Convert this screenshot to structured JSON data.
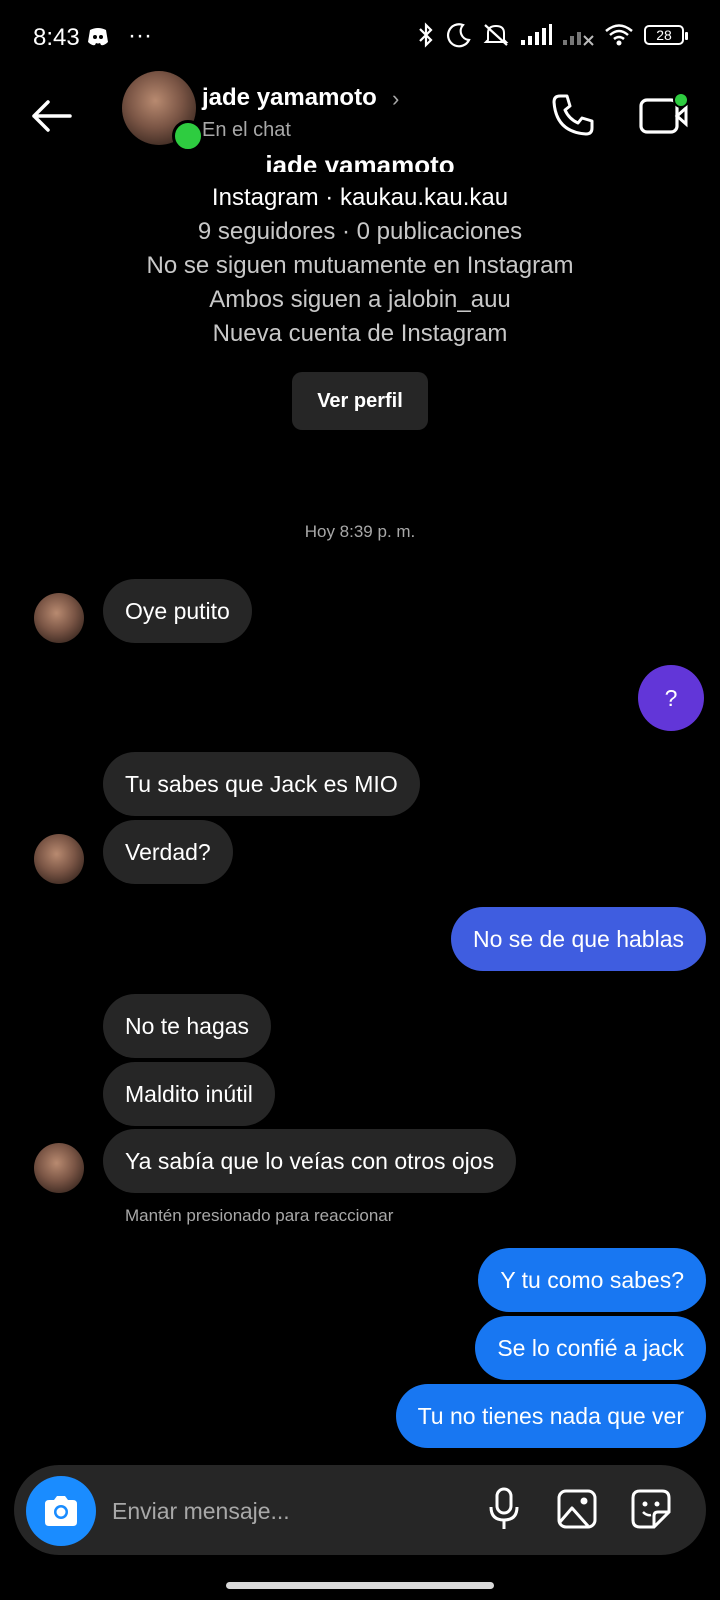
{
  "status": {
    "time": "8:43",
    "more": "···",
    "battery": "28"
  },
  "header": {
    "name": "jade yamamoto",
    "subtitle": "En el chat",
    "chevron": "›"
  },
  "profile": {
    "name": "jade yamamoto",
    "handle": "Instagram · kaukau.kau.kau",
    "stats": "9 seguidores · 0 publicaciones",
    "mutual": "No se siguen mutuamente en Instagram",
    "common": "Ambos siguen a jalobin_auu",
    "newacct": "Nueva cuenta de Instagram",
    "view_button": "Ver perfil"
  },
  "timestamp": "Hoy 8:39 p. m.",
  "messages": {
    "m1": "Oye putito",
    "m2": "?",
    "m3": "Tu sabes que Jack es MIO",
    "m4": "Verdad?",
    "m5": "No se de que hablas",
    "m6": "No te hagas",
    "m7": "Maldito inútil",
    "m8": "Ya sabía que lo veías con otros ojos",
    "m9": "Y tu como sabes?",
    "m10": "Se lo confié a jack",
    "m11": "Tu no tienes nada que ver"
  },
  "hint": "Mantén presionado para reaccionar",
  "composer": {
    "placeholder": "Enviar mensaje..."
  },
  "colors": {
    "incoming": "#262626",
    "outgoing_purple": "#6236d8",
    "outgoing_indigo": "#3f5de0",
    "outgoing_blue": "#1877f2",
    "online": "#2ecc40",
    "camera_button": "#1a8cff"
  },
  "icons": [
    "back-arrow-icon",
    "phone-icon",
    "video-call-icon",
    "camera-icon",
    "microphone-icon",
    "gallery-icon",
    "sticker-icon",
    "bluetooth-icon",
    "moon-icon",
    "mute-icon",
    "signal-icon",
    "wifi-icon",
    "battery-icon"
  ]
}
